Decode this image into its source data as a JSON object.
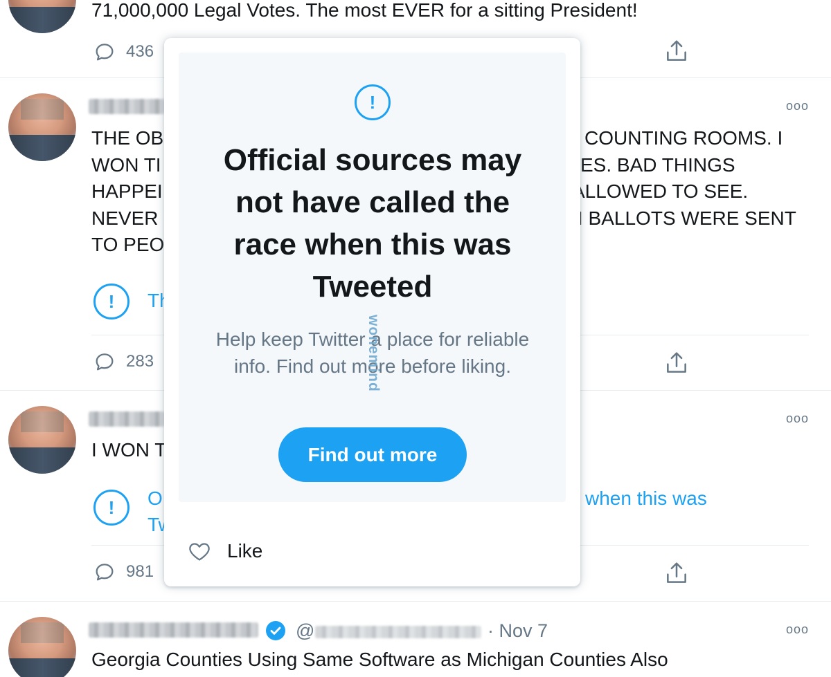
{
  "tweets": [
    {
      "text_lines": [
        "71,000,000 Legal Votes. The most EVER for a sitting President!"
      ],
      "reply_count": "436"
    },
    {
      "left_text_lines": [
        "THE OB",
        "WON TI",
        "HAPPEI",
        "NEVER",
        "TO PEO"
      ],
      "right_text_lines": [
        "COUNTING ROOMS. I",
        "ES. BAD THINGS",
        "ALLOWED TO SEE.",
        "I BALLOTS WERE SENT"
      ],
      "warning_partial": "Th",
      "reply_count": "283"
    },
    {
      "left_text_lines": [
        "I WON T"
      ],
      "warning_partial_lines": [
        "O",
        "Tw"
      ],
      "warning_right": "when this was",
      "reply_count": "981"
    },
    {
      "handle_prefix": "@",
      "timestamp": "· Nov 7",
      "text_lines": [
        "Georgia Counties Using Same Software as Michigan Counties Also"
      ]
    }
  ],
  "popup": {
    "icon": "exclamation-icon",
    "heading_lines": [
      "Official sources may",
      "not have called the",
      "race when this was",
      "Tweeted"
    ],
    "subtext": "Help keep Twitter a place for reliable info. Find out more before liking.",
    "button_label": "Find out more",
    "like_label": "Like",
    "watermark": "wonemind"
  },
  "colors": {
    "accent": "#1da1f2",
    "text": "#14171a",
    "secondary": "#657786",
    "divider": "#e6ecf0",
    "panel_bg": "#f5f8fa",
    "verified": "#1da1f2"
  }
}
